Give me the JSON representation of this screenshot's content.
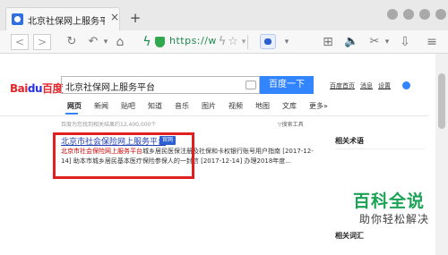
{
  "tabs": [
    {
      "title": "北京社保网上服务平台_...",
      "close_label": "×"
    }
  ],
  "new_tab_label": "+",
  "toolbar": {
    "back_label": "<",
    "forward_label": ">",
    "reload_label": "↻",
    "undo_label": "↶",
    "dropdown_label": "▾",
    "address": "https://w",
    "lightning_label": "ϟ",
    "star_label": "☆",
    "grid_label": "⊞",
    "audio_label": "🔈",
    "cut_label": "✂",
    "download_label": "⇩",
    "menu_label": "≡",
    "overflow_label": "»"
  },
  "page": {
    "logo": {
      "part1": "Bai",
      "part2": "du",
      "part3": "百度"
    },
    "search_query": "北京社保网上服务平台",
    "search_button": "百度一下",
    "top_links": [
      "百度首页",
      "消息",
      "设置"
    ],
    "nav_tabs": [
      "网页",
      "新闻",
      "贴吧",
      "知道",
      "音乐",
      "图片",
      "视频",
      "地图",
      "文库",
      "更多»"
    ],
    "stats": "百度为您找到相关结果约12,400,000个",
    "search_tools": "▽搜索工具",
    "result": {
      "title": "北京市社会保险网上服务平台",
      "badge": "官网",
      "snippet_hl1": "北京市社会保险网上服务平台",
      "snippet_rest1": "城乡居民医保注册及社保和卡权银行账号用户指南 [2017-12-14] 助本市城乡居民基本医疗保险参保人的一封信 [2017-12-14] 办理2018年度..."
    },
    "sidebar": {
      "heading1": "相关术语",
      "heading2": "相关词汇"
    }
  },
  "watermark": {
    "main": "百科全说",
    "sub": "助你轻松解决"
  },
  "colors": {
    "accent_blue": "#3385ff",
    "link_blue": "#2440b3",
    "highlight_red": "#e01f1f",
    "watermark_green": "#1aa255"
  }
}
